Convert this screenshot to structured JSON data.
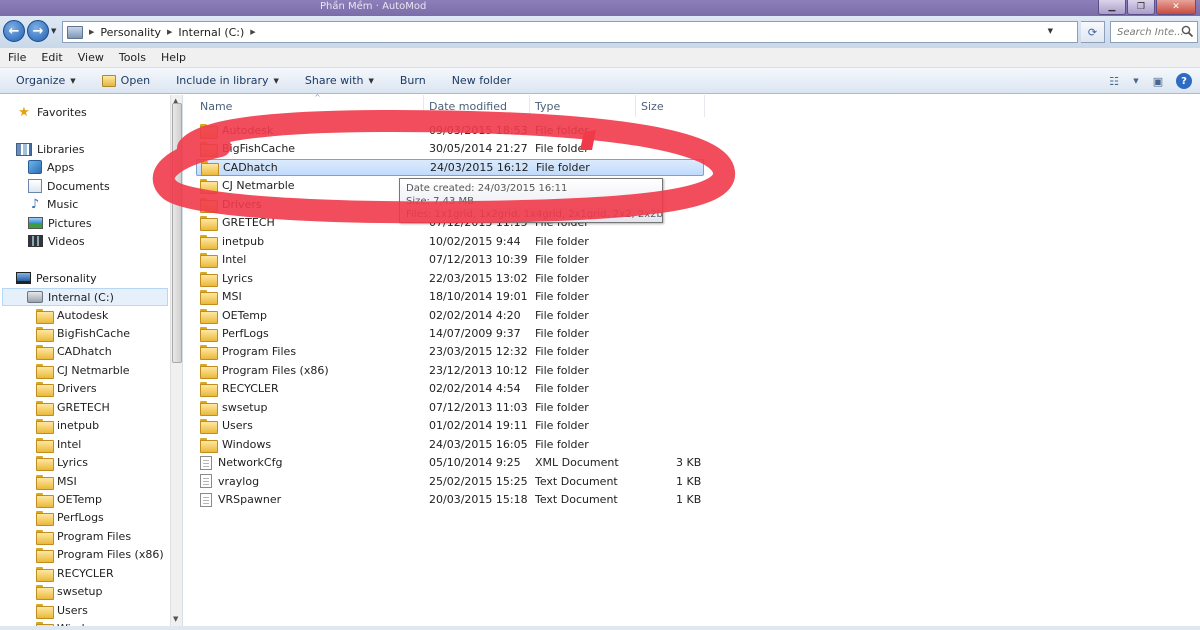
{
  "window": {
    "title": "Phần Mềm · AutoMod"
  },
  "address": {
    "crumbs": [
      "Personality",
      "Internal (C:)"
    ],
    "search_placeholder": "Search Inte..."
  },
  "menu": [
    "File",
    "Edit",
    "View",
    "Tools",
    "Help"
  ],
  "commands": {
    "organize": "Organize",
    "open": "Open",
    "include": "Include in library",
    "share": "Share with",
    "burn": "Burn",
    "newfolder": "New folder"
  },
  "nav": {
    "favorites": "Favorites",
    "libraries": "Libraries",
    "lib_items": [
      "Apps",
      "Documents",
      "Music",
      "Pictures",
      "Videos"
    ],
    "computer": "Personality",
    "drive": "Internal (C:)",
    "folders": [
      "Autodesk",
      "BigFishCache",
      "CADhatch",
      "CJ Netmarble",
      "Drivers",
      "GRETECH",
      "inetpub",
      "Intel",
      "Lyrics",
      "MSI",
      "OETemp",
      "PerfLogs",
      "Program Files",
      "Program Files (x86)",
      "RECYCLER",
      "swsetup",
      "Users",
      "Windows"
    ]
  },
  "columns": {
    "name": "Name",
    "date": "Date modified",
    "type": "Type",
    "size": "Size"
  },
  "files": [
    {
      "name": "Autodesk",
      "date": "09/03/2015 18:53",
      "type": "File folder",
      "size": "",
      "kind": "folder"
    },
    {
      "name": "BigFishCache",
      "date": "30/05/2014 21:27",
      "type": "File folder",
      "size": "",
      "kind": "folder"
    },
    {
      "name": "CADhatch",
      "date": "24/03/2015 16:12",
      "type": "File folder",
      "size": "",
      "kind": "folder"
    },
    {
      "name": "CJ Netmarble",
      "date": "",
      "type": "",
      "size": "",
      "kind": "folder"
    },
    {
      "name": "Drivers",
      "date": "",
      "type": "",
      "size": "",
      "kind": "folder"
    },
    {
      "name": "GRETECH",
      "date": "07/12/2013 11:15",
      "type": "File folder",
      "size": "",
      "kind": "folder"
    },
    {
      "name": "inetpub",
      "date": "10/02/2015 9:44",
      "type": "File folder",
      "size": "",
      "kind": "folder"
    },
    {
      "name": "Intel",
      "date": "07/12/2013 10:39",
      "type": "File folder",
      "size": "",
      "kind": "folder"
    },
    {
      "name": "Lyrics",
      "date": "22/03/2015 13:02",
      "type": "File folder",
      "size": "",
      "kind": "folder"
    },
    {
      "name": "MSI",
      "date": "18/10/2014 19:01",
      "type": "File folder",
      "size": "",
      "kind": "folder"
    },
    {
      "name": "OETemp",
      "date": "02/02/2014 4:20",
      "type": "File folder",
      "size": "",
      "kind": "folder"
    },
    {
      "name": "PerfLogs",
      "date": "14/07/2009 9:37",
      "type": "File folder",
      "size": "",
      "kind": "folder"
    },
    {
      "name": "Program Files",
      "date": "23/03/2015 12:32",
      "type": "File folder",
      "size": "",
      "kind": "folder"
    },
    {
      "name": "Program Files (x86)",
      "date": "23/12/2013 10:12",
      "type": "File folder",
      "size": "",
      "kind": "folder"
    },
    {
      "name": "RECYCLER",
      "date": "02/02/2014 4:54",
      "type": "File folder",
      "size": "",
      "kind": "folder"
    },
    {
      "name": "swsetup",
      "date": "07/12/2013 11:03",
      "type": "File folder",
      "size": "",
      "kind": "folder"
    },
    {
      "name": "Users",
      "date": "01/02/2014 19:11",
      "type": "File folder",
      "size": "",
      "kind": "folder"
    },
    {
      "name": "Windows",
      "date": "24/03/2015 16:05",
      "type": "File folder",
      "size": "",
      "kind": "folder"
    },
    {
      "name": "NetworkCfg",
      "date": "05/10/2014 9:25",
      "type": "XML Document",
      "size": "3 KB",
      "kind": "file"
    },
    {
      "name": "vraylog",
      "date": "25/02/2015 15:25",
      "type": "Text Document",
      "size": "1 KB",
      "kind": "file"
    },
    {
      "name": "VRSpawner",
      "date": "20/03/2015 15:18",
      "type": "Text Document",
      "size": "1 KB",
      "kind": "file"
    }
  ],
  "tooltip": {
    "created": "Date created: 24/03/2015 16:11",
    "size": "Size: 7,43 MB",
    "files": "Files: 1x1grid, 1x2grid, 1x4grid, 2x1grid, 2x2, 2x2brick, ..."
  },
  "colors": {
    "annotation": "#f03a4a",
    "selection": "#cce4fb",
    "accent": "#1e3a64"
  }
}
